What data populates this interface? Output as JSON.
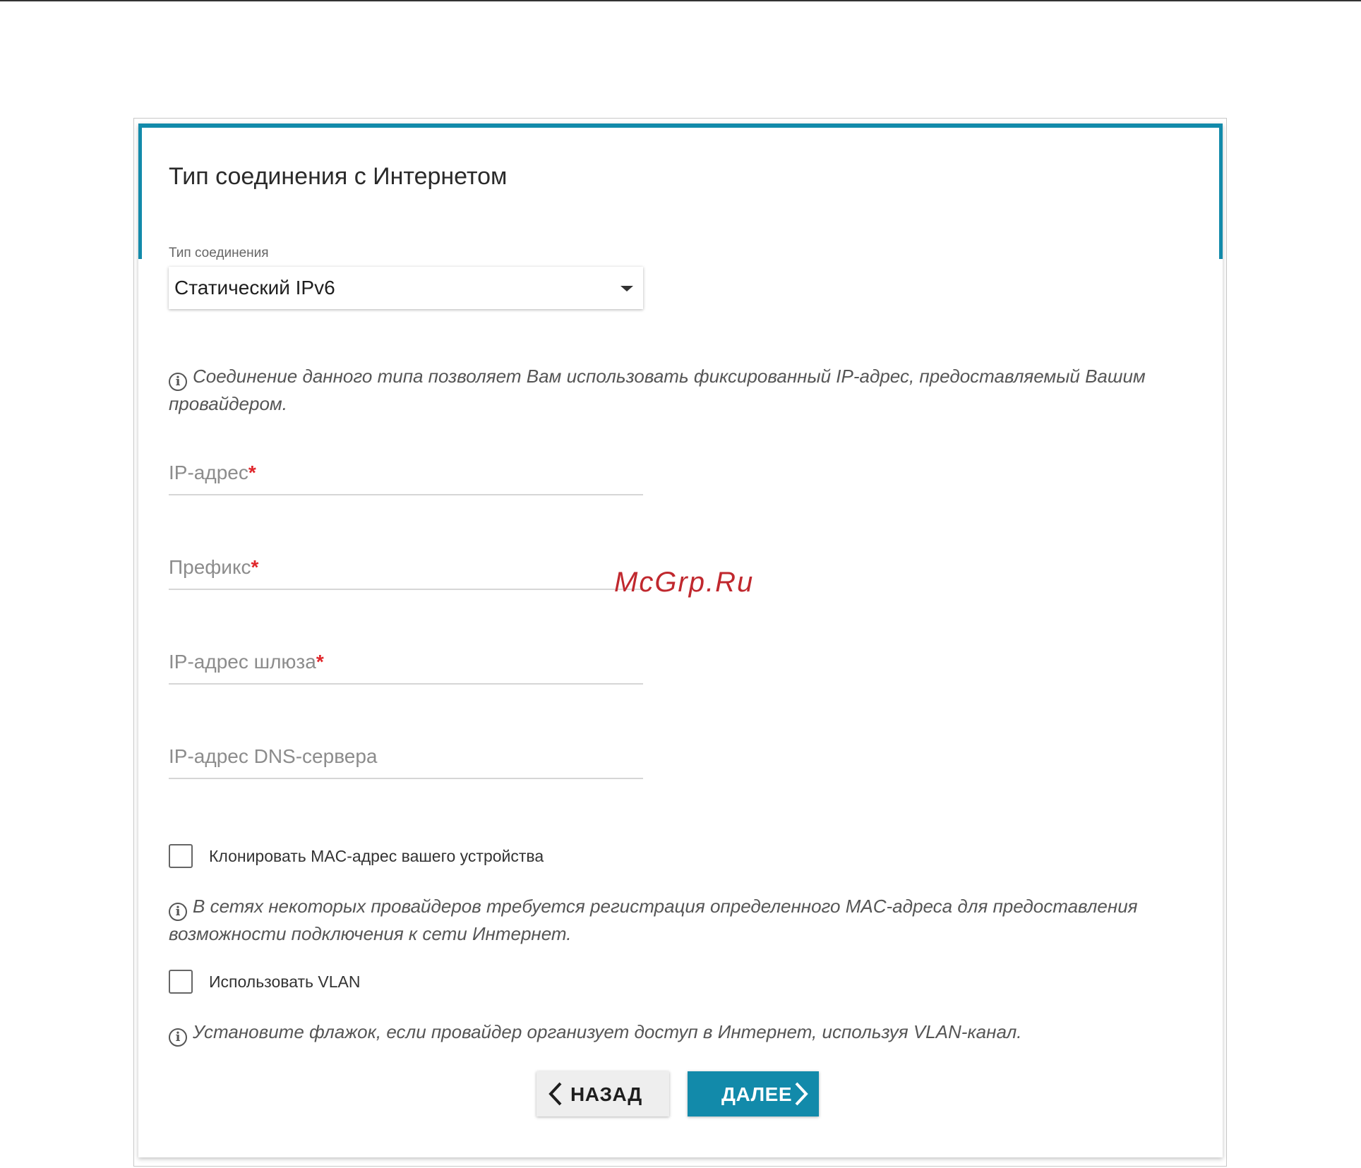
{
  "page": {
    "title": "Тип соединения с Интернетом"
  },
  "connection_type": {
    "label": "Тип соединения",
    "value": "Статический IPv6"
  },
  "info": {
    "connection": "Соединение данного типа позволяет Вам использовать фиксированный IP-адрес, предоставляемый Вашим провайдером.",
    "mac": "В сетях некоторых провайдеров требуется регистрация определенного MAC-адреса для предоставления возможности подключения к сети Интернет.",
    "vlan": "Установите флажок, если провайдер организует доступ в Интернет, используя VLAN-канал."
  },
  "fields": {
    "ip_address": {
      "label": "IP-адрес",
      "required_mark": "*",
      "value": ""
    },
    "prefix": {
      "label": "Префикс",
      "required_mark": "*",
      "value": ""
    },
    "gateway": {
      "label": "IP-адрес шлюза",
      "required_mark": "*",
      "value": ""
    },
    "dns": {
      "label": "IP-адрес DNS-сервера",
      "value": ""
    }
  },
  "checkboxes": {
    "clone_mac": {
      "label": "Клонировать MAC-адрес вашего устройства",
      "checked": false
    },
    "use_vlan": {
      "label": "Использовать VLAN",
      "checked": false
    }
  },
  "buttons": {
    "back": "НАЗАД",
    "next": "ДАЛЕЕ"
  },
  "watermark": "McGrp.Ru",
  "colors": {
    "accent": "#128aaa",
    "required": "#e0262b",
    "watermark": "#c0282e"
  },
  "icons": {
    "info": "info-circle-icon",
    "back": "chevron-left-icon",
    "next": "chevron-right-icon",
    "dropdown": "caret-down-icon"
  }
}
